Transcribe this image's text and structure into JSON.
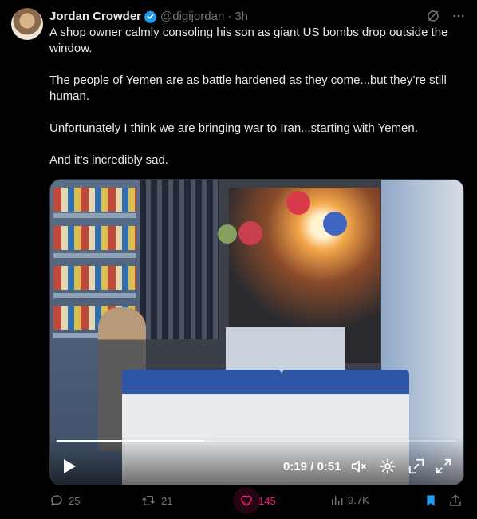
{
  "author": {
    "name": "Jordan Crowder",
    "handle": "@digijordan",
    "time": "3h",
    "verified_color": "#1d9bf0"
  },
  "tweet": {
    "paragraphs": [
      "A shop owner calmly consoling his son as giant US bombs drop outside the window.",
      "The people of Yemen are as battle hardened as they come...but they’re still human.",
      "Unfortunately I think we are bringing war to Iran...starting with Yemen.",
      "And it’s incredibly sad."
    ]
  },
  "video": {
    "time_readout": "0:19 / 0:51",
    "progress_fraction": 0.37
  },
  "actions": {
    "replies": "25",
    "reposts": "21",
    "likes": "145",
    "views": "9.7K",
    "like_color": "#f91880",
    "bookmark_color": "#1d9bf0"
  },
  "icons": [
    "verified-badge-icon",
    "grok-icon",
    "more-icon",
    "play-icon",
    "mute-icon",
    "settings-icon",
    "exit-fullscreen-icon",
    "fullscreen-icon",
    "reply-icon",
    "repost-icon",
    "heart-icon",
    "views-icon",
    "bookmark-icon",
    "share-icon"
  ]
}
